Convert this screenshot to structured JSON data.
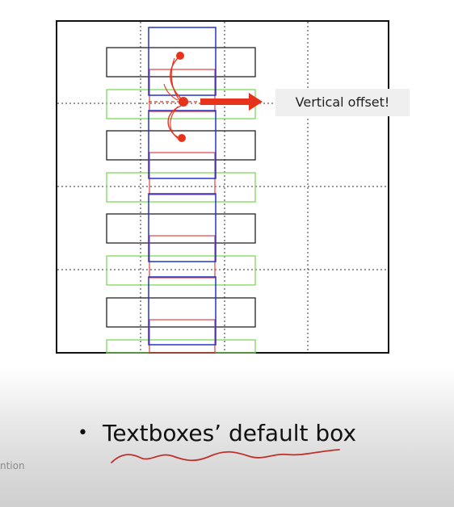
{
  "callout": {
    "text": "Vertical offset!"
  },
  "bullet": {
    "text": "Textboxes’ default box"
  },
  "footer": {
    "text": "ntion"
  },
  "colors": {
    "grid_frame": "#111111",
    "black_box": "#222222",
    "green_box": "#7ed957",
    "blue_box": "#2233cc",
    "red_box": "#e04040",
    "annotation": "#e8331c"
  }
}
